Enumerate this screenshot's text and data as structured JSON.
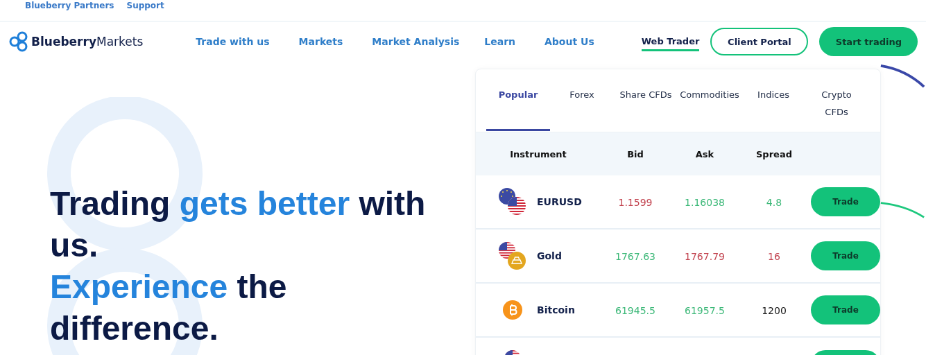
{
  "top_links": [
    "Blueberry Partners",
    "Support"
  ],
  "logo": {
    "bold": "Blueberry",
    "light": "Markets"
  },
  "nav": [
    "Trade with us",
    "Markets",
    "Market Analysis",
    "Learn",
    "About Us"
  ],
  "web_trader": "Web Trader",
  "client_portal": "Client Portal",
  "start_trading": "Start trading",
  "headline": [
    [
      {
        "text": "Trading ",
        "accent": false
      },
      {
        "text": "gets better",
        "accent": true
      },
      {
        "text": " with us.",
        "accent": false
      }
    ],
    [
      {
        "text": "Experience",
        "accent": true
      },
      {
        "text": " the difference.",
        "accent": false
      }
    ]
  ],
  "tabs": [
    {
      "label": "Popular",
      "selected": true
    },
    {
      "label": "Forex",
      "selected": false
    },
    {
      "label": "Share CFDs",
      "selected": false
    },
    {
      "label": "Commodities",
      "selected": false
    },
    {
      "label": "Indices",
      "selected": false
    },
    {
      "label": "Crypto CFDs",
      "selected": false
    }
  ],
  "columns": [
    "Instrument",
    "Bid",
    "Ask",
    "Spread"
  ],
  "rows": [
    {
      "kind": "pair",
      "name": "EURUSD",
      "bid": {
        "text": "1.1599",
        "color": "#c2434f"
      },
      "ask": {
        "text": "1.16038",
        "color": "#3cb878"
      },
      "spread": {
        "text": "4.8",
        "color": "#3cb878"
      },
      "button": "Trade"
    },
    {
      "kind": "commodity",
      "name": "Gold",
      "bid": {
        "text": "1767.63",
        "color": "#3cb878"
      },
      "ask": {
        "text": "1767.79",
        "color": "#c2434f"
      },
      "spread": {
        "text": "16",
        "color": "#c2434f"
      },
      "button": "Trade"
    },
    {
      "kind": "crypto",
      "name": "Bitcoin",
      "bid": {
        "text": "61945.5",
        "color": "#3cb878"
      },
      "ask": {
        "text": "61957.5",
        "color": "#3cb878"
      },
      "spread": {
        "text": "1200",
        "color": "#1a1a1a"
      },
      "button": "Trade"
    },
    {
      "kind": "partial"
    }
  ]
}
